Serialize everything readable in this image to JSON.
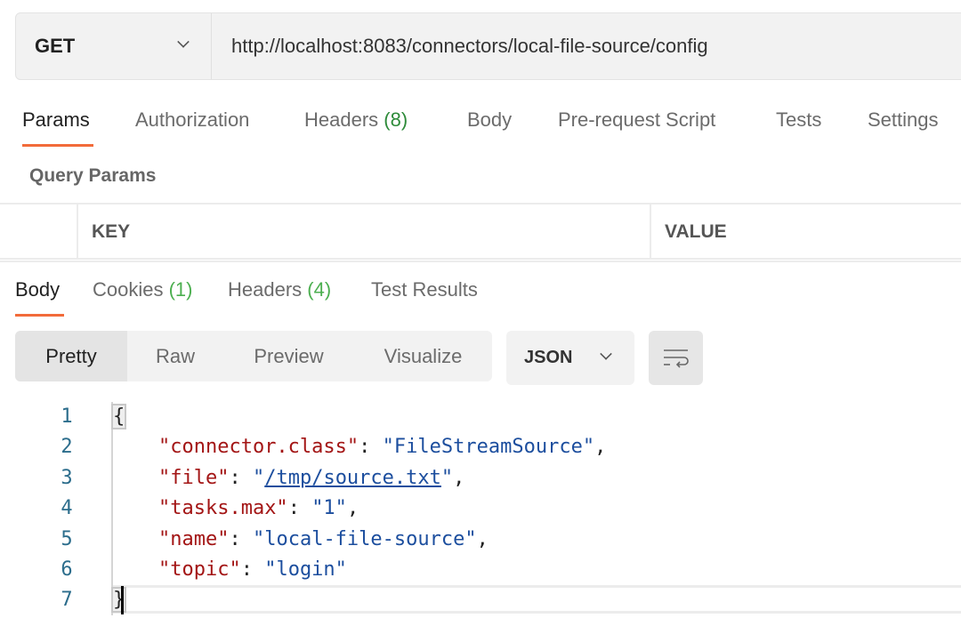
{
  "request": {
    "method": "GET",
    "url": "http://localhost:8083/connectors/local-file-source/config",
    "tabs": [
      {
        "label": "Params",
        "count": null,
        "active": true
      },
      {
        "label": "Authorization",
        "count": null
      },
      {
        "label": "Headers",
        "count": "(8)"
      },
      {
        "label": "Body",
        "count": null
      },
      {
        "label": "Pre-request Script",
        "count": null
      },
      {
        "label": "Tests",
        "count": null
      },
      {
        "label": "Settings",
        "count": null
      }
    ],
    "query_params_title": "Query Params",
    "columns": [
      "KEY",
      "VALUE"
    ]
  },
  "response": {
    "tabs": [
      {
        "label": "Body",
        "count": null,
        "active": true
      },
      {
        "label": "Cookies",
        "count": "(1)"
      },
      {
        "label": "Headers",
        "count": "(4)"
      },
      {
        "label": "Test Results",
        "count": null
      }
    ],
    "view_modes": [
      "Pretty",
      "Raw",
      "Preview",
      "Visualize"
    ],
    "selected_view": "Pretty",
    "format": "JSON",
    "wrap_icon": "text-wrap-icon",
    "code": {
      "line_numbers": [
        "1",
        "2",
        "3",
        "4",
        "5",
        "6",
        "7"
      ],
      "open": "{",
      "close": "}",
      "entries": [
        {
          "key": "\"connector.class\"",
          "value": "\"FileStreamSource\"",
          "comma": ","
        },
        {
          "key": "\"file\"",
          "value": "/tmp/source.txt",
          "comma": ","
        },
        {
          "key": "\"tasks.max\"",
          "value": "\"1\"",
          "comma": ","
        },
        {
          "key": "\"name\"",
          "value": "\"local-file-source\"",
          "comma": ","
        },
        {
          "key": "\"topic\"",
          "value": "\"login\"",
          "comma": ""
        }
      ]
    }
  },
  "colors": {
    "accent": "#f26b3a",
    "count_green": "#2e8b3a",
    "json_key": "#a31515",
    "json_string": "#1c4e9e"
  }
}
